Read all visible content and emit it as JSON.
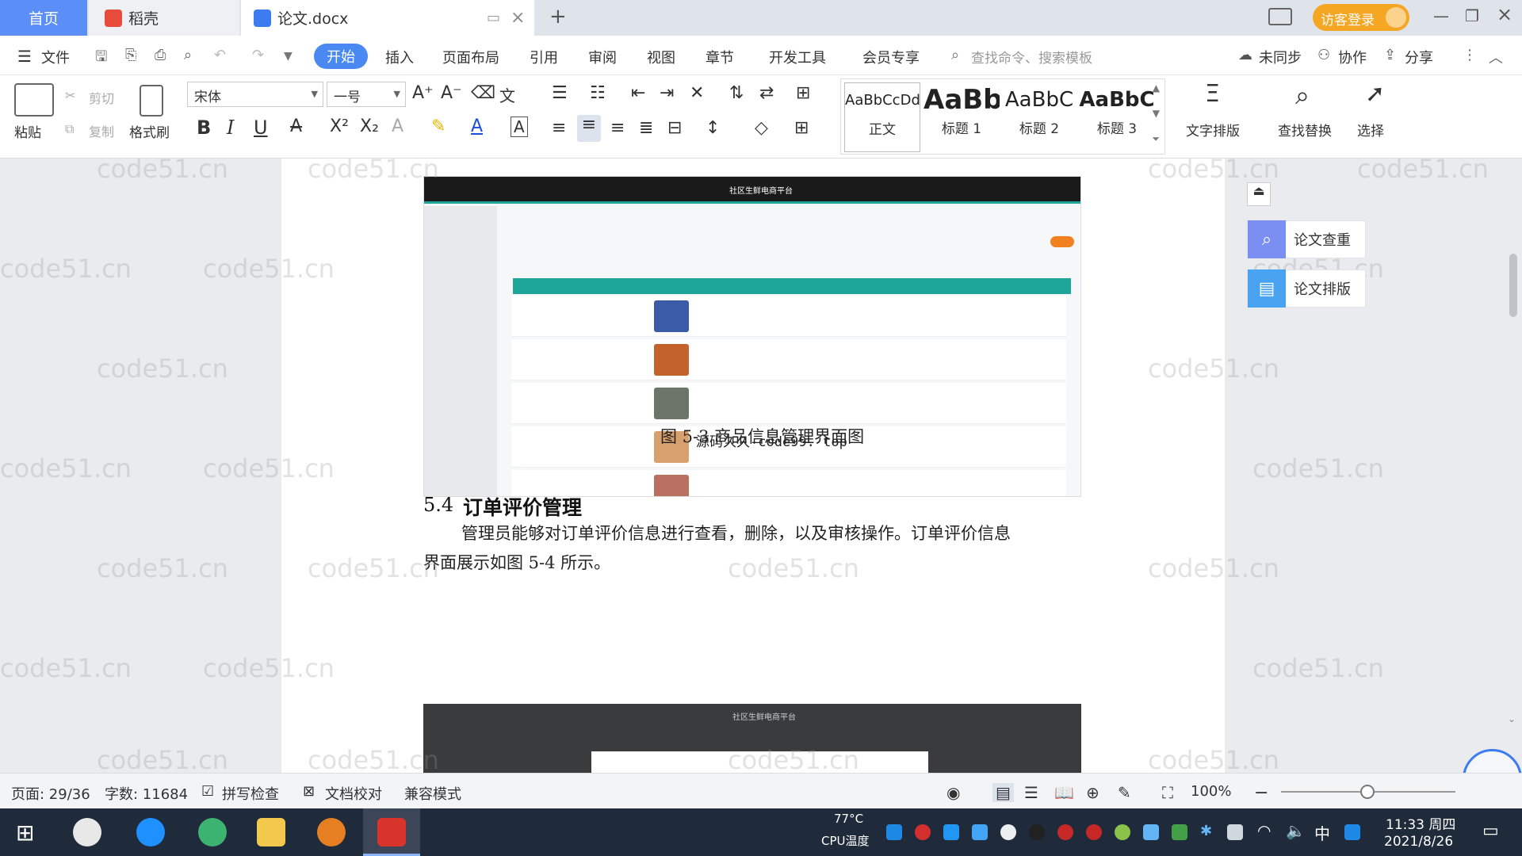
{
  "tabs": {
    "home": "首页",
    "daoke": "稻壳",
    "doc": "论文.docx",
    "new_tab": "+"
  },
  "window": {
    "visitor_login": "访客登录"
  },
  "menu": {
    "file": "文件",
    "items": [
      "开始",
      "插入",
      "页面布局",
      "引用",
      "审阅",
      "视图",
      "章节",
      "开发工具",
      "会员专享"
    ],
    "search_placeholder": "查找命令、搜索模板",
    "not_synced": "未同步",
    "collaborate": "协作",
    "share": "分享"
  },
  "ribbon": {
    "paste": "粘贴",
    "cut": "剪切",
    "copy": "复制",
    "format_painter": "格式刷",
    "font_name": "宋体",
    "font_size": "一号",
    "styles": [
      {
        "sample": "AaBbCcDd",
        "label": "正文"
      },
      {
        "sample": "AaBb",
        "label": "标题 1"
      },
      {
        "sample": "AaBbC",
        "label": "标题 2"
      },
      {
        "sample": "AaBbC",
        "label": "标题 3"
      }
    ],
    "text_layout": "文字排版",
    "find_replace": "查找替换",
    "select": "选择"
  },
  "document": {
    "figure_caption": "图 5-3 商品信息管理界面图",
    "section_number": "5.4",
    "section_title": "订单评价管理",
    "paragraph_line1": "管理员能够对订单评价信息进行查看，删除，以及审核操作。订单评价信息",
    "paragraph_line2": "界面展示如图 5-4 所示。",
    "image_overlay_text": "源码久久-code99. top",
    "embedded_app_title": "社区生鲜电商平台",
    "embedded_app_title2": "社区生鲜电商平台"
  },
  "side_panel": {
    "check": "论文查重",
    "layout": "论文排版"
  },
  "status": {
    "page": "页面: 29/36",
    "words": "字数: 11684",
    "spell_check": "拼写检查",
    "doc_proof": "文档校对",
    "compat_mode": "兼容模式",
    "zoom": "100%"
  },
  "taskbar": {
    "cpu_temp": "77°C",
    "cpu_label": "CPU温度",
    "ime": "中",
    "time": "11:33 周四",
    "date": "2021/8/26"
  },
  "watermark": "code51.cn",
  "colors": {
    "accent": "#4a88f2",
    "home_tab": "#5b8ff7",
    "visitor_btn": "#f5a623",
    "teal_header": "#1fa69a"
  }
}
